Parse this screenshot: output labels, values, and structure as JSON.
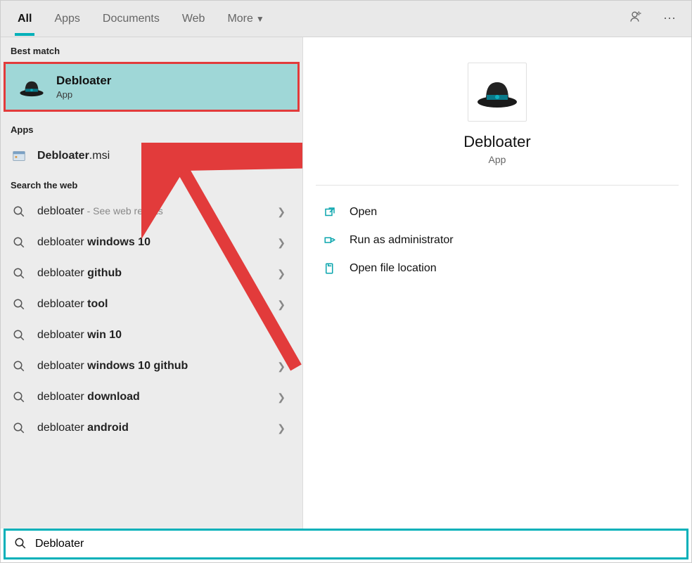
{
  "tabs": {
    "all": "All",
    "apps": "Apps",
    "documents": "Documents",
    "web": "Web",
    "more": "More"
  },
  "sections": {
    "bestMatch": "Best match",
    "apps": "Apps",
    "searchWeb": "Search the web"
  },
  "bestMatch": {
    "title": "Debloater",
    "sub": "App"
  },
  "appsList": [
    {
      "prefix": "Debloater",
      "suffix": ".msi"
    }
  ],
  "webResults": [
    {
      "term": "debloater",
      "bold": "",
      "faded": " - See web results"
    },
    {
      "term": "debloater ",
      "bold": "windows 10",
      "faded": ""
    },
    {
      "term": "debloater ",
      "bold": "github",
      "faded": ""
    },
    {
      "term": "debloater ",
      "bold": "tool",
      "faded": ""
    },
    {
      "term": "debloater ",
      "bold": "win 10",
      "faded": ""
    },
    {
      "term": "debloater ",
      "bold": "windows 10 github",
      "faded": ""
    },
    {
      "term": "debloater ",
      "bold": "download",
      "faded": ""
    },
    {
      "term": "debloater ",
      "bold": "android",
      "faded": ""
    }
  ],
  "preview": {
    "title": "Debloater",
    "sub": "App"
  },
  "actions": {
    "open": "Open",
    "runAdmin": "Run as administrator",
    "openLocation": "Open file location"
  },
  "search": {
    "value": "Debloater"
  }
}
